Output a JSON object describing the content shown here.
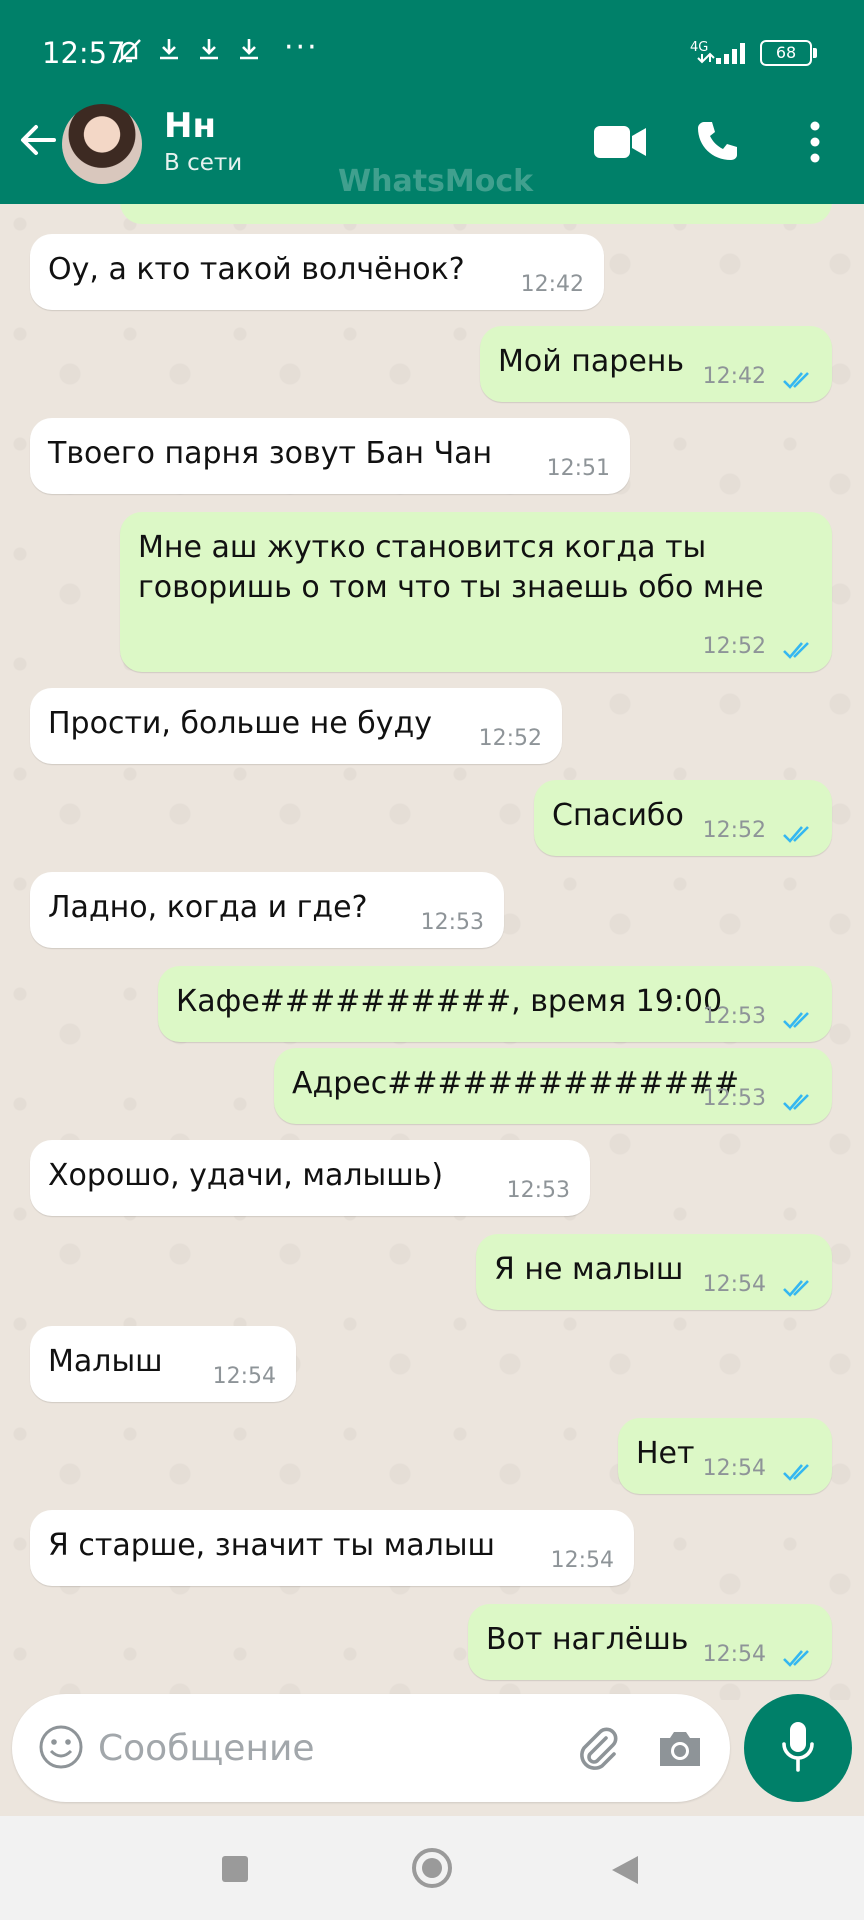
{
  "status_bar": {
    "time": "12:57",
    "network": "4G",
    "battery": "68"
  },
  "header": {
    "name": "Нн",
    "status": "В сети",
    "watermark": "WhatsMock"
  },
  "messages": [
    {
      "dir": "in",
      "text": "Оу, а кто такой волчёнок?",
      "time": "12:42"
    },
    {
      "dir": "out",
      "text": "Мой парень",
      "time": "12:42"
    },
    {
      "dir": "in",
      "text": "Твоего парня зовут Бан Чан",
      "time": "12:51"
    },
    {
      "dir": "out",
      "text": "Мне аш жутко становится когда ты\nговоришь о том что ты знаешь обо мне",
      "time": "12:52"
    },
    {
      "dir": "in",
      "text": "Прости, больше не буду",
      "time": "12:52"
    },
    {
      "dir": "out",
      "text": "Спасибо",
      "time": "12:52"
    },
    {
      "dir": "in",
      "text": "Ладно, когда и где?",
      "time": "12:53"
    },
    {
      "dir": "out",
      "text": "Кафе##########, время 19:00",
      "time": "12:53"
    },
    {
      "dir": "out",
      "text": "Адрес##############",
      "time": "12:53"
    },
    {
      "dir": "in",
      "text": "Хорошо, удачи, малышь)",
      "time": "12:53"
    },
    {
      "dir": "out",
      "text": "Я не малыш",
      "time": "12:54"
    },
    {
      "dir": "in",
      "text": "Малыш",
      "time": "12:54"
    },
    {
      "dir": "out",
      "text": "Нет",
      "time": "12:54"
    },
    {
      "dir": "in",
      "text": "Я старше, значит ты малыш",
      "time": "12:54"
    },
    {
      "dir": "out",
      "text": "Вот наглёшь",
      "time": "12:54"
    }
  ],
  "composer": {
    "placeholder": "Сообщение"
  },
  "colors": {
    "accent": "#008069",
    "bubble_out": "#dcf8c6",
    "bubble_in": "#ffffff",
    "read_ticks": "#34b7f1"
  },
  "icons": [
    "back-arrow-icon",
    "video-call-icon",
    "phone-icon",
    "more-vert-icon",
    "emoji-icon",
    "attach-icon",
    "camera-icon",
    "mic-icon"
  ]
}
